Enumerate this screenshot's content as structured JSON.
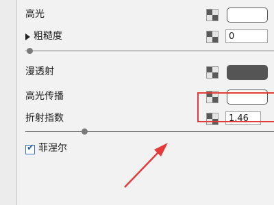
{
  "properties": {
    "specular": {
      "label": "高光",
      "swatch_color": "#ffffff"
    },
    "roughness": {
      "label": "粗糙度",
      "value": "0",
      "slider_level": 0
    },
    "diffuse_transmission": {
      "label": "漫透射",
      "swatch_color": "#555555"
    },
    "specular_transmission": {
      "label": "高光传播",
      "swatch_color": "#ffffff"
    },
    "ior": {
      "label": "折射指数",
      "value": "1.46",
      "slider_level": 0.27
    }
  },
  "fresnel": {
    "label": "菲涅尔",
    "checked": true,
    "check_glyph": "✔"
  },
  "icons": {
    "map_button": "checker-map-icon",
    "expand": "triangle-right-icon",
    "annotation_arrow": "red-arrow-annotation",
    "highlight": "red-highlight-box"
  },
  "colors": {
    "highlight": "#e53a3a",
    "checkbox": "#3a74c9"
  }
}
